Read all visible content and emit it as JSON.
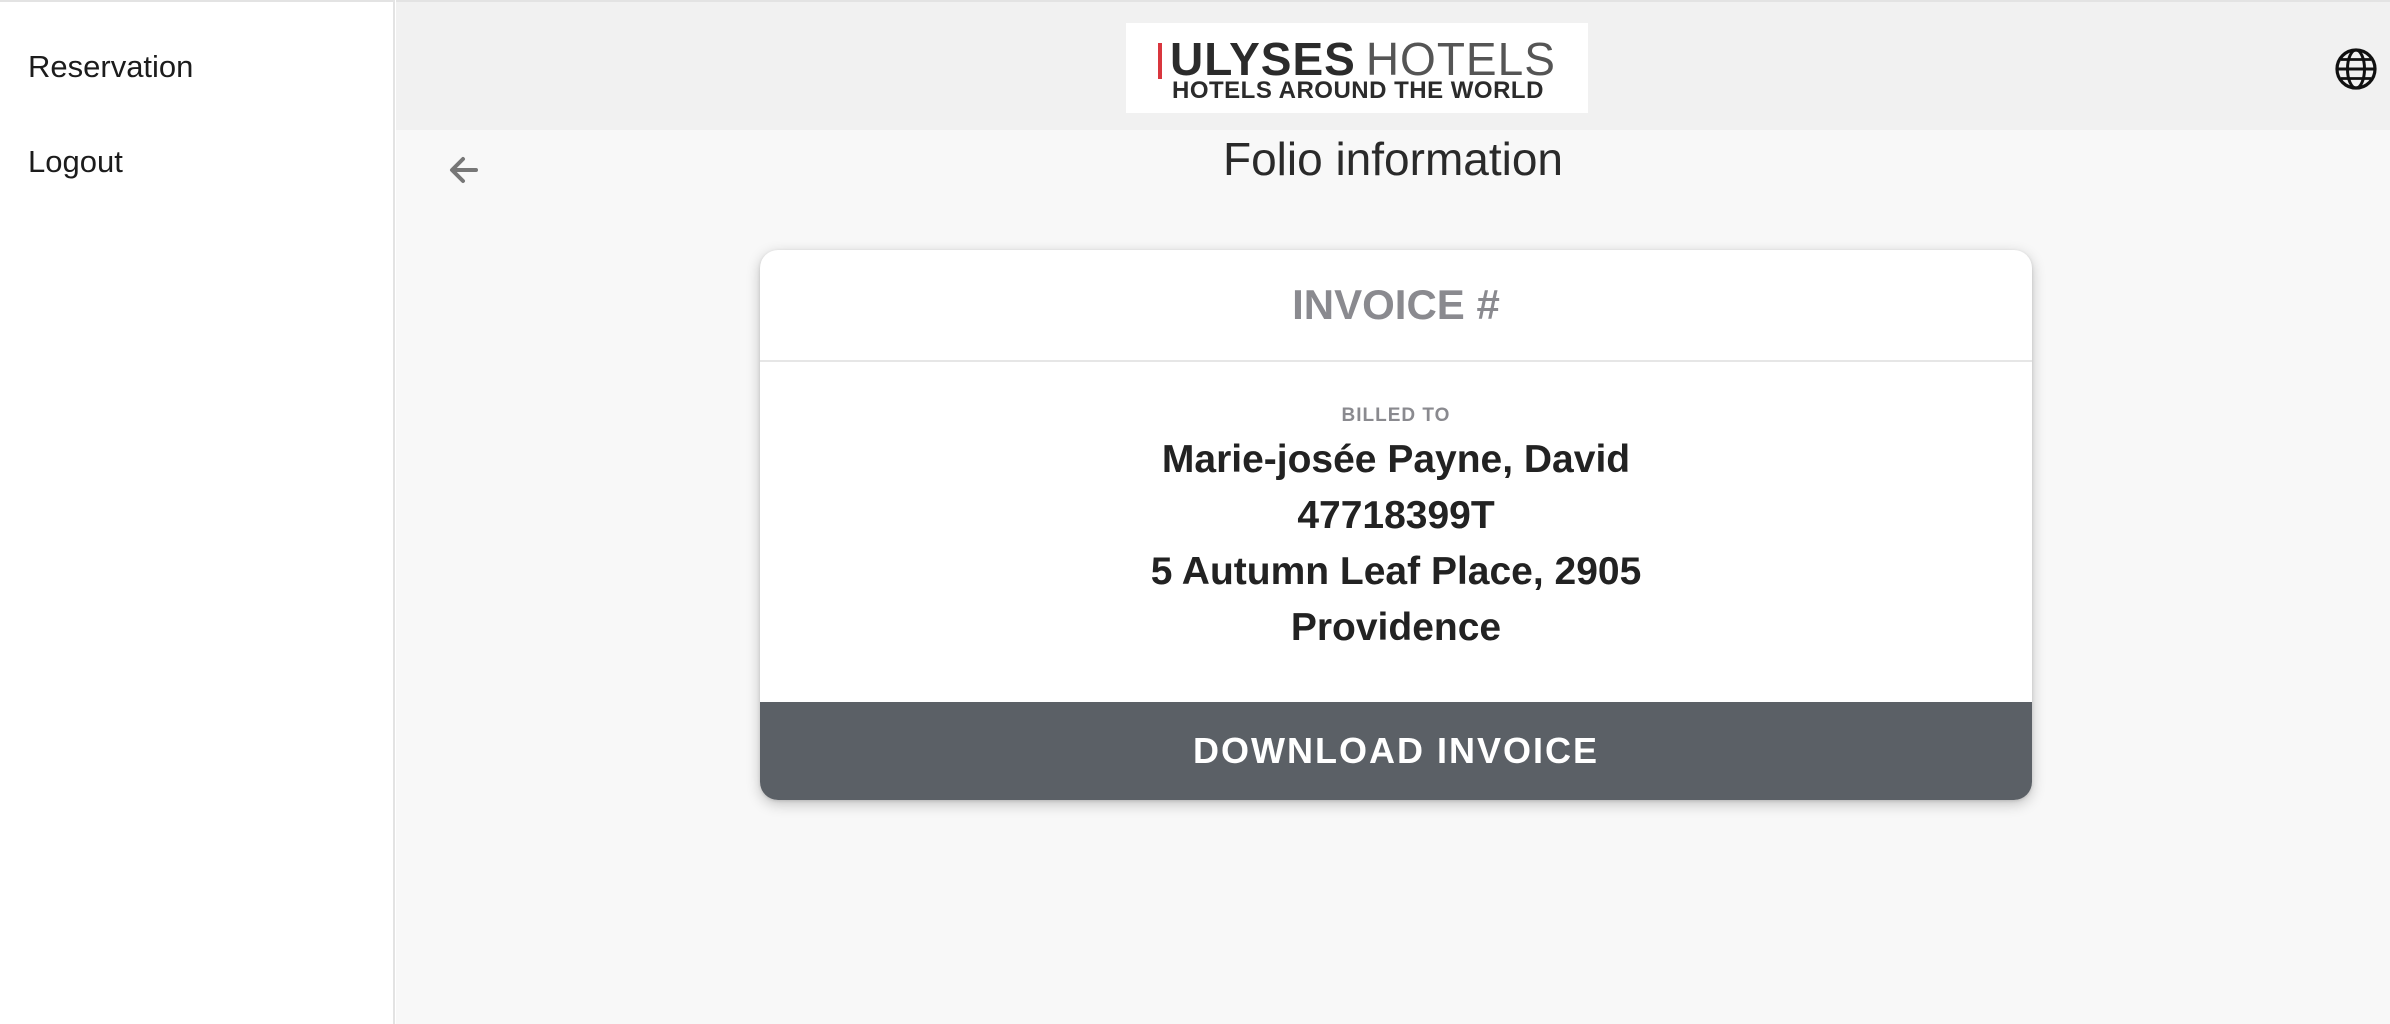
{
  "sidebar": {
    "items": [
      {
        "label": "Reservation"
      },
      {
        "label": "Logout"
      }
    ]
  },
  "header": {
    "logo": {
      "brand": "ULYSES",
      "suffix": "HOTELS",
      "tagline": "HOTELS AROUND THE WORLD",
      "accent_color": "#d9363e"
    },
    "language_icon": "globe-icon"
  },
  "page": {
    "back_icon": "arrow-left-icon",
    "title": "Folio information"
  },
  "invoice": {
    "title": "INVOICE #",
    "billed_to_label": "BILLED TO",
    "billed_to": [
      "Marie-josée Payne, David",
      "47718399T",
      "5 Autumn Leaf Place, 2905",
      "Providence"
    ],
    "download_label": "DOWNLOAD INVOICE",
    "download_button_color": "#5b6066"
  }
}
